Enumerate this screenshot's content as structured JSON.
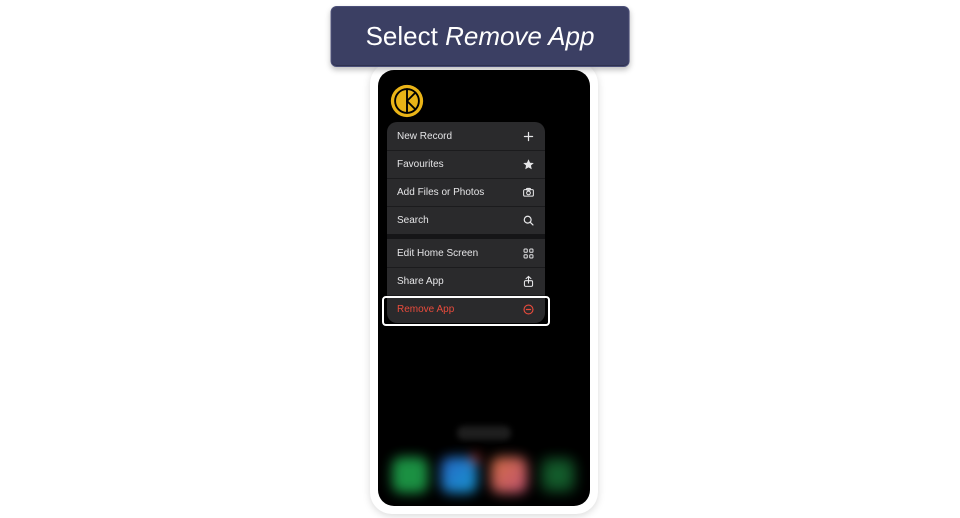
{
  "instruction": {
    "prefix": "Select ",
    "emphasis": "Remove App"
  },
  "colors": {
    "banner_bg": "#3b3f63",
    "destructive": "#e94b3c",
    "app_icon": "#eab417"
  },
  "app_icon": {
    "name": "keeper-app-icon"
  },
  "menu": {
    "groups": [
      [
        {
          "id": "new-record",
          "label": "New Record",
          "icon": "plus-icon",
          "destructive": false
        },
        {
          "id": "favourites",
          "label": "Favourites",
          "icon": "star-icon",
          "destructive": false
        },
        {
          "id": "add-files",
          "label": "Add Files or Photos",
          "icon": "camera-icon",
          "destructive": false
        },
        {
          "id": "search",
          "label": "Search",
          "icon": "search-icon",
          "destructive": false
        }
      ],
      [
        {
          "id": "edit-home",
          "label": "Edit Home Screen",
          "icon": "apps-icon",
          "destructive": false
        },
        {
          "id": "share-app",
          "label": "Share App",
          "icon": "share-icon",
          "destructive": false
        },
        {
          "id": "remove-app",
          "label": "Remove App",
          "icon": "minus-circle-icon",
          "destructive": true
        }
      ]
    ]
  }
}
